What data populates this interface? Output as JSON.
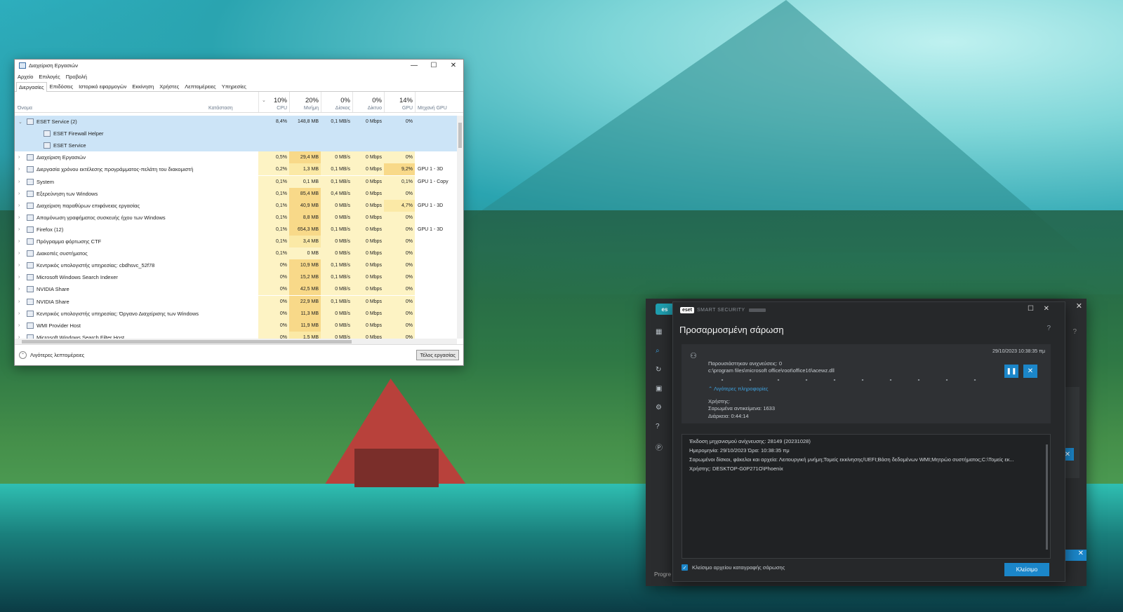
{
  "taskmanager": {
    "title": "Διαχείριση Εργασιών",
    "menu": [
      "Αρχείο",
      "Επιλογές",
      "Προβολή"
    ],
    "tabs": [
      "Διεργασίες",
      "Επιδόσεις",
      "Ιστορικό εφαρμογών",
      "Εκκίνηση",
      "Χρήστες",
      "Λεπτομέρειες",
      "Υπηρεσίες"
    ],
    "columns": {
      "name": "Όνομα",
      "status": "Κατάσταση",
      "cpu_pct": "10%",
      "cpu": "CPU",
      "mem_pct": "20%",
      "mem": "Μνήμη",
      "disk_pct": "0%",
      "disk": "Δίσκος",
      "net_pct": "0%",
      "net": "Δίκτυο",
      "gpu_pct": "14%",
      "gpu": "GPU",
      "gpu_engine": "Μηχανή GPU"
    },
    "rows": [
      {
        "name": "ESET Service (2)",
        "cpu": "8,4%",
        "mem": "148,8 MB",
        "disk": "0,1 MB/s",
        "net": "0 Mbps",
        "gpu": "0%",
        "engine": "",
        "expanded": true
      },
      {
        "name": "ESET Firewall Helper",
        "cpu": "",
        "mem": "",
        "disk": "",
        "net": "",
        "gpu": "",
        "engine": "",
        "child": true
      },
      {
        "name": "ESET Service",
        "cpu": "",
        "mem": "",
        "disk": "",
        "net": "",
        "gpu": "",
        "engine": "",
        "child": true
      },
      {
        "name": "Διαχείριση Εργασιών",
        "cpu": "0,5%",
        "mem": "29,4 MB",
        "disk": "0 MB/s",
        "net": "0 Mbps",
        "gpu": "0%",
        "engine": ""
      },
      {
        "name": "Διεργασία χρόνου εκτέλεσης προγράμματος-πελάτη του διακομιστή",
        "cpu": "0,2%",
        "mem": "1,3 MB",
        "disk": "0,1 MB/s",
        "net": "0 Mbps",
        "gpu": "9,2%",
        "engine": "GPU 1 - 3D"
      },
      {
        "name": "System",
        "cpu": "0,1%",
        "mem": "0,1 MB",
        "disk": "0,1 MB/s",
        "net": "0 Mbps",
        "gpu": "0,1%",
        "engine": "GPU 1 - Copy"
      },
      {
        "name": "Εξερεύνηση των Windows",
        "cpu": "0,1%",
        "mem": "85,4 MB",
        "disk": "0,4 MB/s",
        "net": "0 Mbps",
        "gpu": "0%",
        "engine": ""
      },
      {
        "name": "Διαχείριση παραθύρων επιφάνειας εργασίας",
        "cpu": "0,1%",
        "mem": "40,9 MB",
        "disk": "0 MB/s",
        "net": "0 Mbps",
        "gpu": "4,7%",
        "engine": "GPU 1 - 3D"
      },
      {
        "name": "Απομόνωση γραφήματος συσκευής ήχου των Windows",
        "cpu": "0,1%",
        "mem": "8,8 MB",
        "disk": "0 MB/s",
        "net": "0 Mbps",
        "gpu": "0%",
        "engine": ""
      },
      {
        "name": "Firefox (12)",
        "cpu": "0,1%",
        "mem": "654,3 MB",
        "disk": "0,1 MB/s",
        "net": "0 Mbps",
        "gpu": "0%",
        "engine": "GPU 1 - 3D"
      },
      {
        "name": "Πρόγραμμα φόρτωσης CTF",
        "cpu": "0,1%",
        "mem": "3,4 MB",
        "disk": "0 MB/s",
        "net": "0 Mbps",
        "gpu": "0%",
        "engine": ""
      },
      {
        "name": "Διακοπές συστήματος",
        "cpu": "0,1%",
        "mem": "0 MB",
        "disk": "0 MB/s",
        "net": "0 Mbps",
        "gpu": "0%",
        "engine": ""
      },
      {
        "name": "Κεντρικός υπολογιστής υπηρεσίας: cbdhsvc_52f78",
        "cpu": "0%",
        "mem": "10,9 MB",
        "disk": "0,1 MB/s",
        "net": "0 Mbps",
        "gpu": "0%",
        "engine": ""
      },
      {
        "name": "Microsoft Windows Search Indexer",
        "cpu": "0%",
        "mem": "15,2 MB",
        "disk": "0,1 MB/s",
        "net": "0 Mbps",
        "gpu": "0%",
        "engine": ""
      },
      {
        "name": "NVIDIA Share",
        "cpu": "0%",
        "mem": "42,5 MB",
        "disk": "0 MB/s",
        "net": "0 Mbps",
        "gpu": "0%",
        "engine": ""
      },
      {
        "name": "NVIDIA Share",
        "cpu": "0%",
        "mem": "22,9 MB",
        "disk": "0,1 MB/s",
        "net": "0 Mbps",
        "gpu": "0%",
        "engine": ""
      },
      {
        "name": "Κεντρικός υπολογιστής υπηρεσίας: Όργανο Διαχείρισης των Windows",
        "cpu": "0%",
        "mem": "11,3 MB",
        "disk": "0 MB/s",
        "net": "0 Mbps",
        "gpu": "0%",
        "engine": ""
      },
      {
        "name": "WMI Provider Host",
        "cpu": "0%",
        "mem": "11,9 MB",
        "disk": "0 MB/s",
        "net": "0 Mbps",
        "gpu": "0%",
        "engine": ""
      },
      {
        "name": "Microsoft Windows Search Filter Host",
        "cpu": "0%",
        "mem": "1,5 MB",
        "disk": "0 MB/s",
        "net": "0 Mbps",
        "gpu": "0%",
        "engine": ""
      }
    ],
    "footer": {
      "less_details": "Λιγότερες λεπτομέρειες",
      "end_task": "Τέλος εργασίας"
    }
  },
  "eset_main": {
    "logo": "es",
    "progress_label": "Progre"
  },
  "scan_dialog": {
    "badge": "eset",
    "product": "SMART SECURITY",
    "title": "Προσαρμοσμένη σάρωση",
    "help": "?",
    "timestamp": "29/10/2023 10:38:35 πμ",
    "detections": "Παρουσιάστηκαν ανιχνεύσεις: 0",
    "current_file": "c:\\program files\\microsoft office\\root\\office16\\acewz.dll",
    "less_info": "Λιγότερες πληροφορίες",
    "user_label": "Χρήστης:",
    "scanned_objects": "Σαρωμένα αντικείμενα: 1633",
    "duration": "Διάρκεια: 0:44:14",
    "log_lines": [
      "Έκδοση μηχανισμού ανίχνευσης: 28149 (20231028)",
      "Ημερομηνία: 29/10/2023  Ώρα: 10:38:35 πμ",
      "Σαρωμένοι δίσκοι, φάκελοι και αρχεία: Λειτουργική μνήμη;Τομείς εκκίνησης/UEFI;Βάση δεδομένων WMI;Μητρώο συστήματος;C:\\Τομείς εκ...",
      "Χρήστης: DESKTOP-G0P271O\\Phoenix"
    ],
    "log_checkbox": "Κλείσιμο αρχείου καταγραφής σάρωσης",
    "close_button": "Κλείσιμο"
  }
}
